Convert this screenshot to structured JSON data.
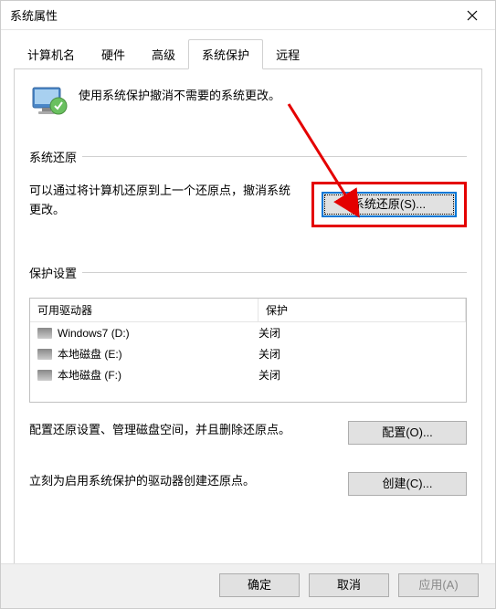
{
  "window": {
    "title": "系统属性"
  },
  "tabs": [
    {
      "label": "计算机名"
    },
    {
      "label": "硬件"
    },
    {
      "label": "高级"
    },
    {
      "label": "系统保护",
      "active": true
    },
    {
      "label": "远程"
    }
  ],
  "intro": {
    "text": "使用系统保护撤消不需要的系统更改。"
  },
  "restore_section": {
    "title": "系统还原",
    "text": "可以通过将计算机还原到上一个还原点，撤消系统更改。",
    "button_label": "系统还原(S)..."
  },
  "protect_section": {
    "title": "保护设置",
    "columns": {
      "drive": "可用驱动器",
      "protect": "保护"
    },
    "drives": [
      {
        "name": "Windows7 (D:)",
        "status": "关闭"
      },
      {
        "name": "本地磁盘 (E:)",
        "status": "关闭"
      },
      {
        "name": "本地磁盘 (F:)",
        "status": "关闭"
      }
    ],
    "config_text": "配置还原设置、管理磁盘空间，并且删除还原点。",
    "config_button": "配置(O)...",
    "create_text": "立刻为启用系统保护的驱动器创建还原点。",
    "create_button": "创建(C)..."
  },
  "footer": {
    "ok": "确定",
    "cancel": "取消",
    "apply": "应用(A)"
  }
}
